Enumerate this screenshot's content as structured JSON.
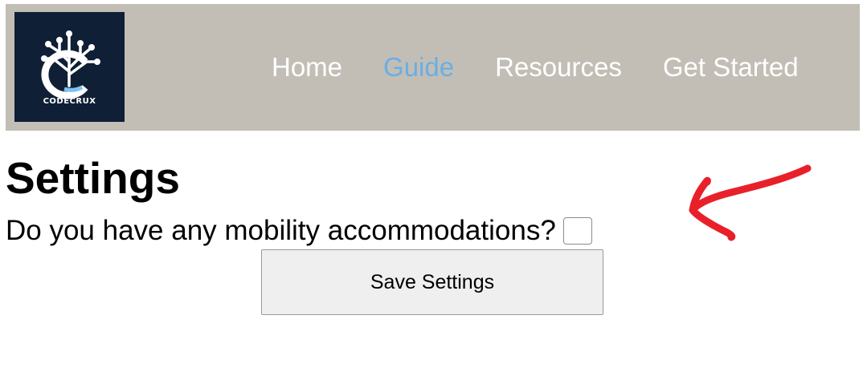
{
  "header": {
    "logo": {
      "text": "CODECRUX",
      "icon": "circuit-tree-logo",
      "background": "#0f1f35"
    },
    "nav": [
      {
        "label": "Home",
        "active": false
      },
      {
        "label": "Guide",
        "active": true
      },
      {
        "label": "Resources",
        "active": false
      },
      {
        "label": "Get Started",
        "active": false
      }
    ],
    "background": "#c2beb6",
    "active_color": "#6aaee6"
  },
  "main": {
    "title": "Settings",
    "question": "Do you have any mobility accommodations?",
    "checkbox_checked": false,
    "save_label": "Save Settings"
  },
  "annotation": {
    "icon": "red-arrow-icon",
    "color": "#e8202a"
  }
}
